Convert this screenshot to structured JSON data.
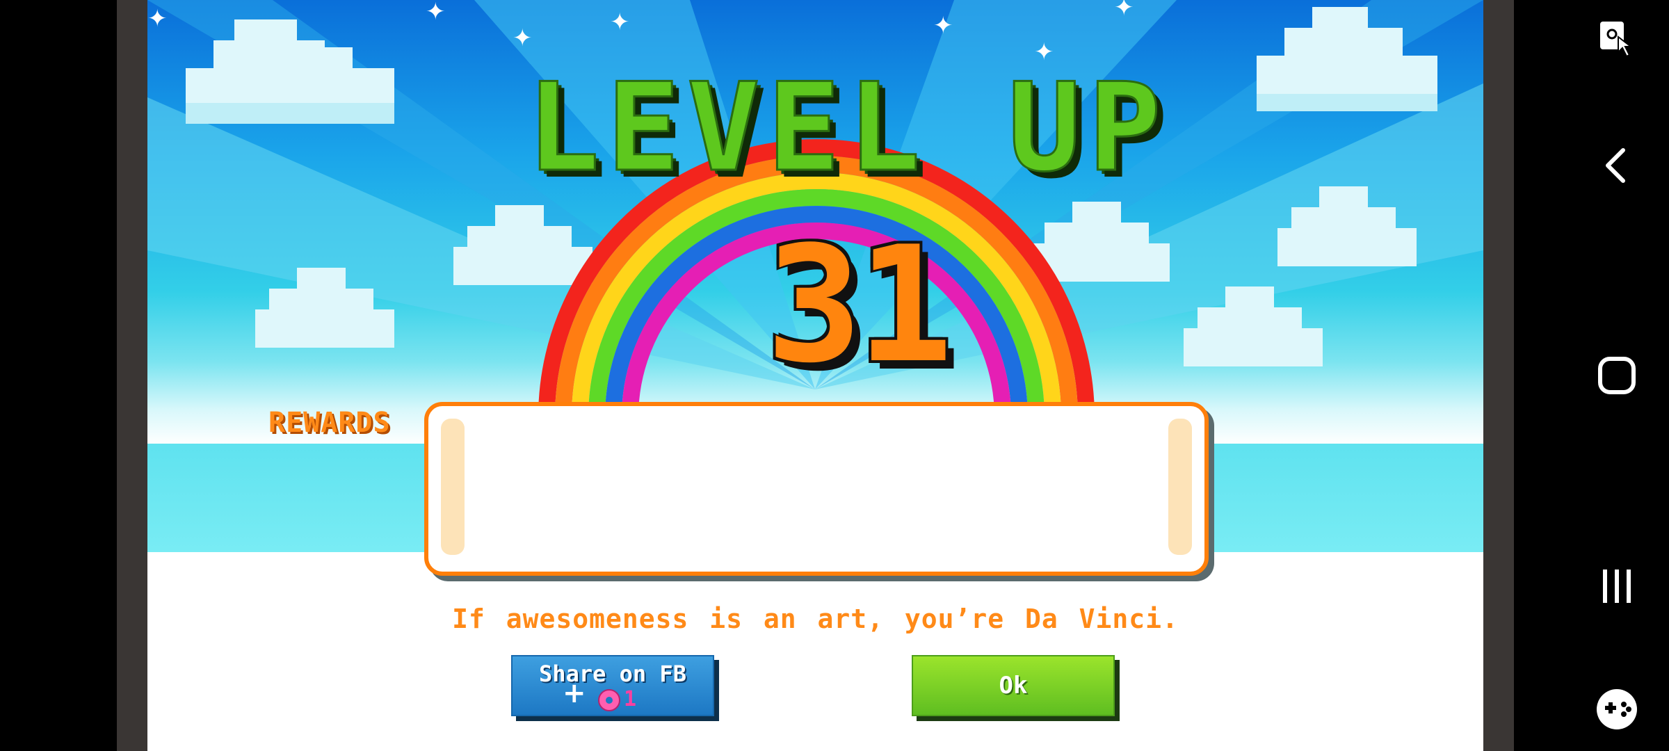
{
  "game": {
    "title": "LEVEL UP",
    "level": "31",
    "rewards_label": "REWARDS",
    "tagline": "If awesomeness is an art, you’re Da Vinci.",
    "share_button": {
      "label": "Share on FB",
      "plus": "+",
      "reward_icon": "donut-icon",
      "reward_count": "1"
    },
    "ok_button": {
      "label": "Ok"
    }
  },
  "system_nav": {
    "items": [
      {
        "icon": "screen-touch-lock-icon"
      },
      {
        "icon": "back-chevron-icon"
      },
      {
        "icon": "home-icon"
      },
      {
        "icon": "recent-apps-icon"
      },
      {
        "icon": "game-controller-icon"
      }
    ]
  },
  "colors": {
    "title_green": "#5ec81e",
    "level_orange": "#ff850e",
    "text_orange": "#ff8a18",
    "share_blue": "#1d78c4",
    "ok_green": "#5fbe21",
    "frame_gray": "#3a3634"
  }
}
